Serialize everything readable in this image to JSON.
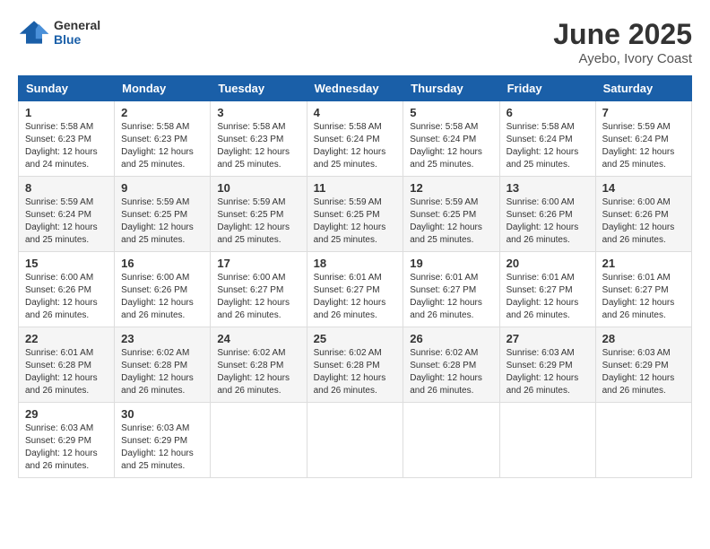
{
  "header": {
    "logo_general": "General",
    "logo_blue": "Blue",
    "month_year": "June 2025",
    "location": "Ayebo, Ivory Coast"
  },
  "days_of_week": [
    "Sunday",
    "Monday",
    "Tuesday",
    "Wednesday",
    "Thursday",
    "Friday",
    "Saturday"
  ],
  "weeks": [
    [
      {
        "day": "1",
        "info": "Sunrise: 5:58 AM\nSunset: 6:23 PM\nDaylight: 12 hours\nand 24 minutes."
      },
      {
        "day": "2",
        "info": "Sunrise: 5:58 AM\nSunset: 6:23 PM\nDaylight: 12 hours\nand 25 minutes."
      },
      {
        "day": "3",
        "info": "Sunrise: 5:58 AM\nSunset: 6:23 PM\nDaylight: 12 hours\nand 25 minutes."
      },
      {
        "day": "4",
        "info": "Sunrise: 5:58 AM\nSunset: 6:24 PM\nDaylight: 12 hours\nand 25 minutes."
      },
      {
        "day": "5",
        "info": "Sunrise: 5:58 AM\nSunset: 6:24 PM\nDaylight: 12 hours\nand 25 minutes."
      },
      {
        "day": "6",
        "info": "Sunrise: 5:58 AM\nSunset: 6:24 PM\nDaylight: 12 hours\nand 25 minutes."
      },
      {
        "day": "7",
        "info": "Sunrise: 5:59 AM\nSunset: 6:24 PM\nDaylight: 12 hours\nand 25 minutes."
      }
    ],
    [
      {
        "day": "8",
        "info": "Sunrise: 5:59 AM\nSunset: 6:24 PM\nDaylight: 12 hours\nand 25 minutes."
      },
      {
        "day": "9",
        "info": "Sunrise: 5:59 AM\nSunset: 6:25 PM\nDaylight: 12 hours\nand 25 minutes."
      },
      {
        "day": "10",
        "info": "Sunrise: 5:59 AM\nSunset: 6:25 PM\nDaylight: 12 hours\nand 25 minutes."
      },
      {
        "day": "11",
        "info": "Sunrise: 5:59 AM\nSunset: 6:25 PM\nDaylight: 12 hours\nand 25 minutes."
      },
      {
        "day": "12",
        "info": "Sunrise: 5:59 AM\nSunset: 6:25 PM\nDaylight: 12 hours\nand 25 minutes."
      },
      {
        "day": "13",
        "info": "Sunrise: 6:00 AM\nSunset: 6:26 PM\nDaylight: 12 hours\nand 26 minutes."
      },
      {
        "day": "14",
        "info": "Sunrise: 6:00 AM\nSunset: 6:26 PM\nDaylight: 12 hours\nand 26 minutes."
      }
    ],
    [
      {
        "day": "15",
        "info": "Sunrise: 6:00 AM\nSunset: 6:26 PM\nDaylight: 12 hours\nand 26 minutes."
      },
      {
        "day": "16",
        "info": "Sunrise: 6:00 AM\nSunset: 6:26 PM\nDaylight: 12 hours\nand 26 minutes."
      },
      {
        "day": "17",
        "info": "Sunrise: 6:00 AM\nSunset: 6:27 PM\nDaylight: 12 hours\nand 26 minutes."
      },
      {
        "day": "18",
        "info": "Sunrise: 6:01 AM\nSunset: 6:27 PM\nDaylight: 12 hours\nand 26 minutes."
      },
      {
        "day": "19",
        "info": "Sunrise: 6:01 AM\nSunset: 6:27 PM\nDaylight: 12 hours\nand 26 minutes."
      },
      {
        "day": "20",
        "info": "Sunrise: 6:01 AM\nSunset: 6:27 PM\nDaylight: 12 hours\nand 26 minutes."
      },
      {
        "day": "21",
        "info": "Sunrise: 6:01 AM\nSunset: 6:27 PM\nDaylight: 12 hours\nand 26 minutes."
      }
    ],
    [
      {
        "day": "22",
        "info": "Sunrise: 6:01 AM\nSunset: 6:28 PM\nDaylight: 12 hours\nand 26 minutes."
      },
      {
        "day": "23",
        "info": "Sunrise: 6:02 AM\nSunset: 6:28 PM\nDaylight: 12 hours\nand 26 minutes."
      },
      {
        "day": "24",
        "info": "Sunrise: 6:02 AM\nSunset: 6:28 PM\nDaylight: 12 hours\nand 26 minutes."
      },
      {
        "day": "25",
        "info": "Sunrise: 6:02 AM\nSunset: 6:28 PM\nDaylight: 12 hours\nand 26 minutes."
      },
      {
        "day": "26",
        "info": "Sunrise: 6:02 AM\nSunset: 6:28 PM\nDaylight: 12 hours\nand 26 minutes."
      },
      {
        "day": "27",
        "info": "Sunrise: 6:03 AM\nSunset: 6:29 PM\nDaylight: 12 hours\nand 26 minutes."
      },
      {
        "day": "28",
        "info": "Sunrise: 6:03 AM\nSunset: 6:29 PM\nDaylight: 12 hours\nand 26 minutes."
      }
    ],
    [
      {
        "day": "29",
        "info": "Sunrise: 6:03 AM\nSunset: 6:29 PM\nDaylight: 12 hours\nand 26 minutes."
      },
      {
        "day": "30",
        "info": "Sunrise: 6:03 AM\nSunset: 6:29 PM\nDaylight: 12 hours\nand 25 minutes."
      },
      null,
      null,
      null,
      null,
      null
    ]
  ]
}
